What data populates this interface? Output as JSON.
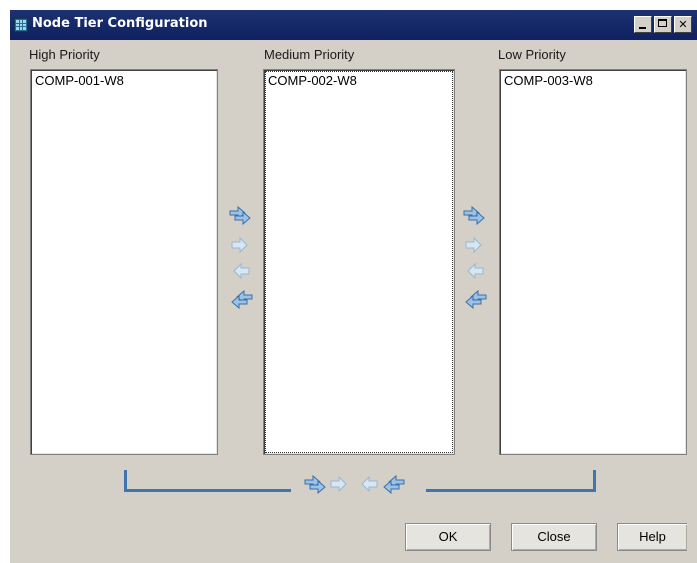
{
  "window": {
    "title": "Node Tier Configuration",
    "controls": {
      "minimize": "minimize",
      "maximize": "maximize",
      "close": "close"
    }
  },
  "columns": [
    {
      "label": "High Priority",
      "items": [
        "COMP-001-W8"
      ]
    },
    {
      "label": "Medium Priority",
      "items": [
        "COMP-002-W8"
      ]
    },
    {
      "label": "Low Priority",
      "items": [
        "COMP-003-W8"
      ]
    }
  ],
  "transfer_controls": {
    "icons": [
      "move-all-right-icon",
      "move-right-icon",
      "move-left-icon",
      "move-all-left-icon"
    ]
  },
  "buttons": {
    "ok": "OK",
    "close": "Close",
    "help": "Help"
  },
  "colors": {
    "titlebar": "#142766",
    "dialog": "#d4d0c8",
    "bracket": "#3f76b0",
    "arrow": "#5c8fc4"
  }
}
